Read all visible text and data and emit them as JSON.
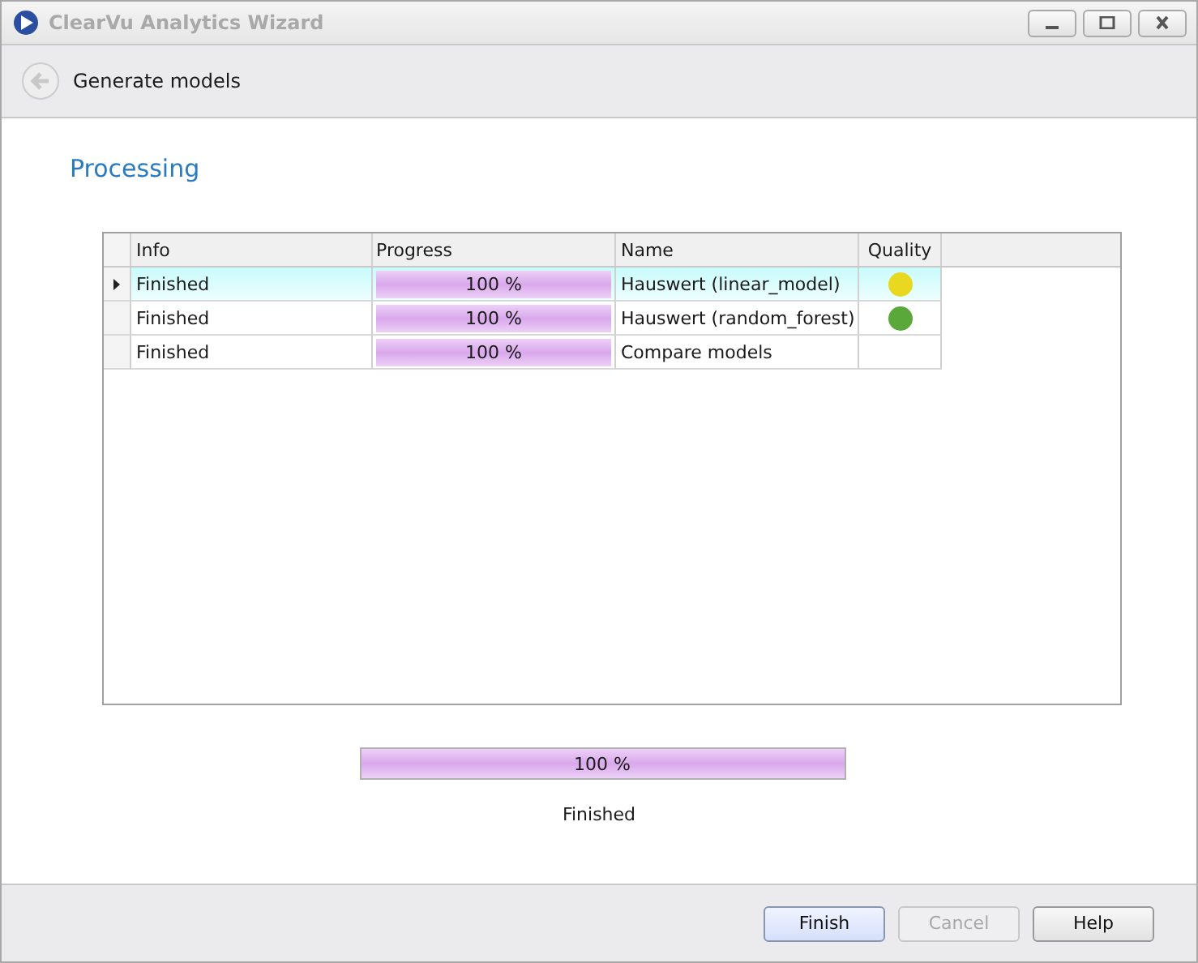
{
  "window": {
    "title": "ClearVu Analytics Wizard"
  },
  "header": {
    "title": "Generate models"
  },
  "section_title": "Processing",
  "table": {
    "columns": [
      "Info",
      "Progress",
      "Name",
      "Quality"
    ],
    "rows": [
      {
        "selected": true,
        "info": "Finished",
        "progress": {
          "level": 1,
          "reading": "100 %"
        },
        "name": "Hauswert (linear_model)",
        "color": "#e8d820"
      },
      {
        "selected": false,
        "info": "Finished",
        "progress": {
          "level": 1,
          "reading": "100 %"
        },
        "name": "Hauswert (random_forest)",
        "color": "#5aa83a"
      },
      {
        "selected": false,
        "info": "Finished",
        "progress": {
          "level": 1,
          "reading": "100 %"
        },
        "name": "Compare models"
      }
    ]
  },
  "overall": {
    "level": 1,
    "reading": "100 %",
    "status": "Finished"
  },
  "buttons": [
    {
      "label": "Finish",
      "kind": "default",
      "disabled": false
    },
    {
      "label": "Cancel",
      "kind": "normal",
      "disabled": true
    },
    {
      "label": "Help",
      "kind": "normal",
      "disabled": false
    }
  ]
}
